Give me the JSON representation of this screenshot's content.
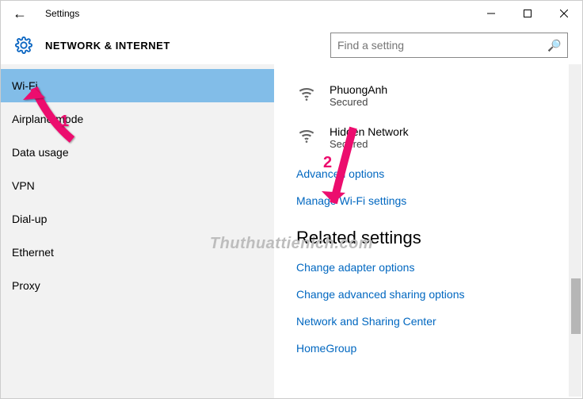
{
  "window": {
    "title": "Settings"
  },
  "header": {
    "page_title": "NETWORK & INTERNET"
  },
  "search": {
    "placeholder": "Find a setting"
  },
  "sidebar": {
    "items": [
      {
        "label": "Wi-Fi",
        "name": "sidebar-item-wifi",
        "active": true
      },
      {
        "label": "Airplane mode",
        "name": "sidebar-item-airplane-mode",
        "active": false
      },
      {
        "label": "Data usage",
        "name": "sidebar-item-data-usage",
        "active": false
      },
      {
        "label": "VPN",
        "name": "sidebar-item-vpn",
        "active": false
      },
      {
        "label": "Dial-up",
        "name": "sidebar-item-dial-up",
        "active": false
      },
      {
        "label": "Ethernet",
        "name": "sidebar-item-ethernet",
        "active": false
      },
      {
        "label": "Proxy",
        "name": "sidebar-item-proxy",
        "active": false
      }
    ]
  },
  "networks": [
    {
      "name": "PhuongAnh",
      "status": "Secured"
    },
    {
      "name": "Hidden Network",
      "status": "Secured"
    }
  ],
  "links": {
    "advanced_options": "Advanced options",
    "manage_wifi": "Manage Wi-Fi settings"
  },
  "related": {
    "title": "Related settings",
    "items": [
      "Change adapter options",
      "Change advanced sharing options",
      "Network and Sharing Center",
      "HomeGroup"
    ]
  },
  "annotations": {
    "arrow1_label": "1",
    "arrow2_label": "2"
  },
  "watermark": "Thuthuattienich.com"
}
